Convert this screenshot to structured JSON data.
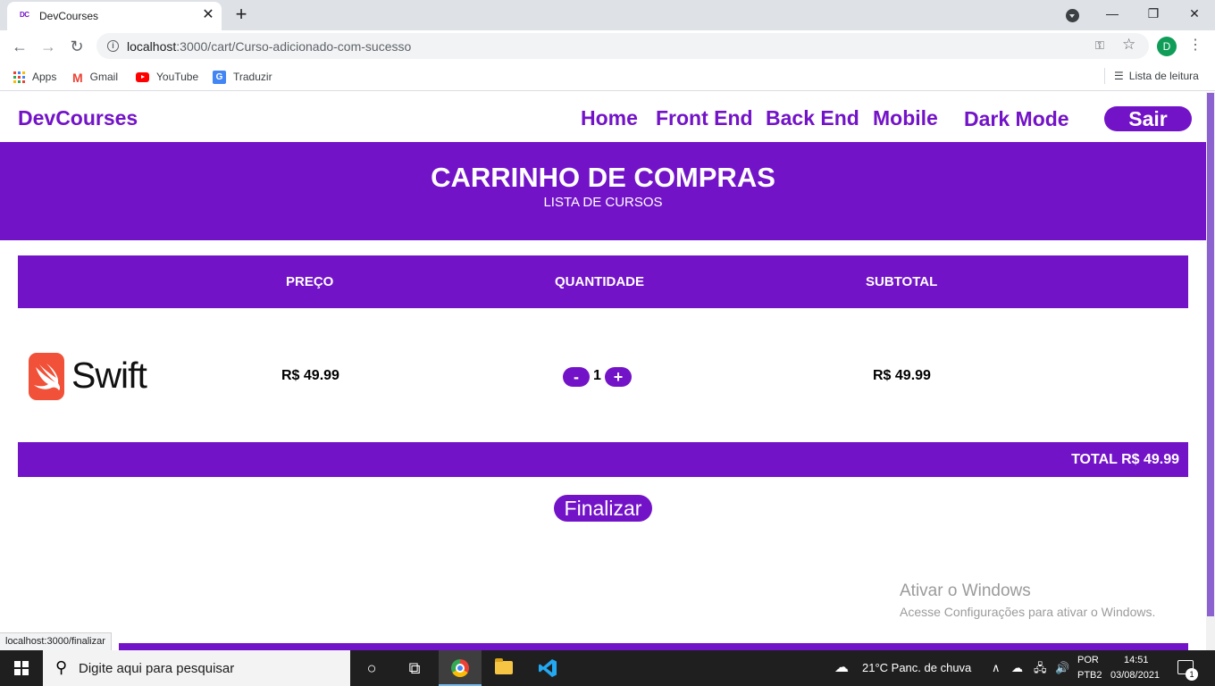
{
  "browser": {
    "tab_title": "DevCourses",
    "tab_favicon": "DC",
    "url_host": "localhost",
    "url_rest": ":3000/cart/Curso-adicionado-com-sucesso",
    "profile_initial": "D",
    "bookmarks": [
      "Apps",
      "Gmail",
      "YouTube",
      "Traduzir"
    ],
    "reading_list": "Lista de leitura",
    "status_url": "localhost:3000/finalizar"
  },
  "site": {
    "brand": "DevCourses",
    "nav": [
      "Home",
      "Front End",
      "Back End",
      "Mobile",
      "Dark Mode"
    ],
    "logout": "Sair",
    "accent_color": "#7313c8"
  },
  "cart": {
    "title": "CARRINHO DE COMPRAS",
    "subtitle": "LISTA DE CURSOS",
    "headers": [
      "PREÇO",
      "QUANTIDADE",
      "SUBTOTAL"
    ],
    "item": {
      "name": "Swift",
      "price": "R$ 49.99",
      "decrement": "-",
      "quantity": "1",
      "increment": "+",
      "subtotal": "R$ 49.99"
    },
    "total": "TOTAL R$ 49.99",
    "checkout": "Finalizar"
  },
  "windows": {
    "activation_title": "Ativar o Windows",
    "activation_text": "Acesse Configurações para ativar o Windows.",
    "search_placeholder": "Digite aqui para pesquisar",
    "weather": "21°C  Panc. de chuva",
    "lang_top": "POR",
    "lang_bottom": "PTB2",
    "time": "14:51",
    "date": "03/08/2021",
    "notification_count": "1"
  }
}
